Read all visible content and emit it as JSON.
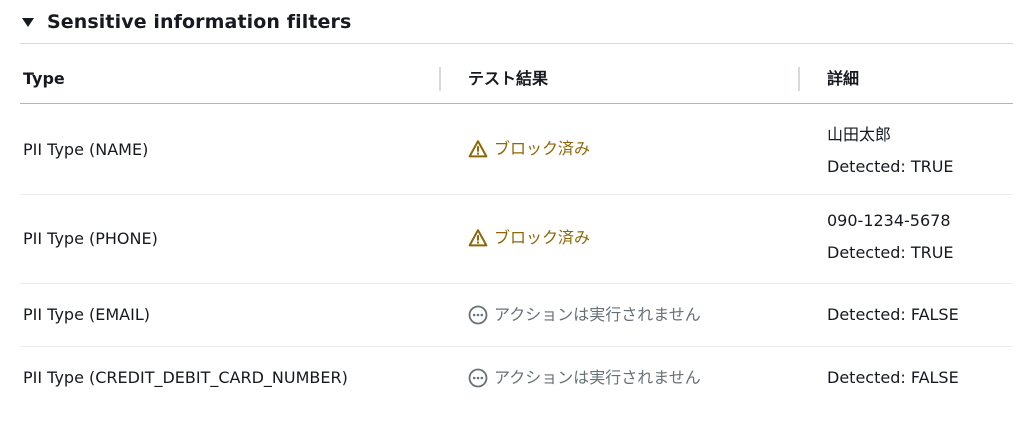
{
  "section": {
    "title": "Sensitive information filters"
  },
  "table": {
    "columns": [
      "Type",
      "テスト結果",
      "詳細"
    ],
    "rows": [
      {
        "type": "PII Type (NAME)",
        "result": "ブロック済み",
        "result_icon": "warning-icon",
        "details": [
          "山田太郎",
          "Detected: TRUE"
        ]
      },
      {
        "type": "PII Type (PHONE)",
        "result": "ブロック済み",
        "result_icon": "warning-icon",
        "details": [
          "090-1234-5678",
          "Detected: TRUE"
        ]
      },
      {
        "type": "PII Type (EMAIL)",
        "result": "アクションは実行されません",
        "result_icon": "ellipsis-circle-icon",
        "details": [
          "Detected: FALSE"
        ]
      },
      {
        "type": "PII Type (CREDIT_DEBIT_CARD_NUMBER)",
        "result": "アクションは実行されません",
        "result_icon": "ellipsis-circle-icon",
        "details": [
          "Detected: FALSE"
        ]
      }
    ]
  },
  "colors": {
    "warning": "#8d6605",
    "muted": "#687078",
    "text": "#16191f"
  }
}
